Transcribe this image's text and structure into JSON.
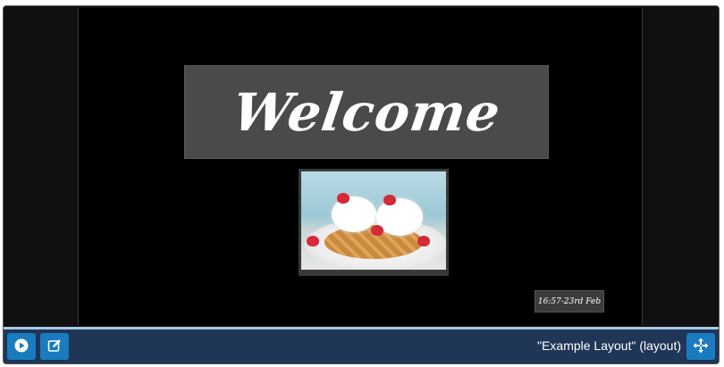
{
  "preview": {
    "welcome_text": "Welcome",
    "clock_text": "16:57-23rd Feb"
  },
  "toolbar": {
    "layout_label": "\"Example Layout\" (layout)",
    "icons": [
      "play-icon",
      "edit-icon",
      "move-icon"
    ]
  },
  "colors": {
    "toolbar_bg": "#1f3656",
    "button_bg": "#1a7bbf",
    "divider": "#a7c9e6",
    "canvas_bg": "#000000"
  }
}
